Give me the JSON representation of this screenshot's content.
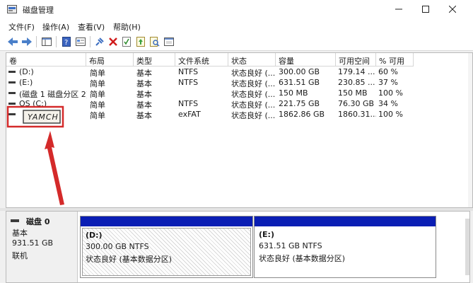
{
  "window": {
    "title": "磁盘管理"
  },
  "menu": [
    "文件(F)",
    "操作(A)",
    "查看(V)",
    "帮助(H)"
  ],
  "columns": [
    "卷",
    "布局",
    "类型",
    "文件系统",
    "状态",
    "容量",
    "可用空间",
    "% 可用"
  ],
  "volumes": [
    {
      "name": "(D:)",
      "layout": "简单",
      "type": "基本",
      "fs": "NTFS",
      "status": "状态良好 (...",
      "capacity": "300.00 GB",
      "free": "179.14 ...",
      "pct": "60 %"
    },
    {
      "name": "(E:)",
      "layout": "简单",
      "type": "基本",
      "fs": "NTFS",
      "status": "状态良好 (...",
      "capacity": "631.51 GB",
      "free": "230.85 ...",
      "pct": "37 %"
    },
    {
      "name": "(磁盘 1 磁盘分区 2)",
      "layout": "简单",
      "type": "基本",
      "fs": "",
      "status": "状态良好 (...",
      "capacity": "150 MB",
      "free": "150 MB",
      "pct": "100 %"
    },
    {
      "name": "OS (C:)",
      "layout": "简单",
      "type": "基本",
      "fs": "NTFS",
      "status": "状态良好 (...",
      "capacity": "221.75 GB",
      "free": "76.30 GB",
      "pct": "34 %"
    },
    {
      "name": "",
      "layout": "简单",
      "type": "基本",
      "fs": "exFAT",
      "status": "状态良好 (...",
      "capacity": "1862.86 GB",
      "free": "1860.31...",
      "pct": "100 %"
    }
  ],
  "disk0": {
    "label": "磁盘 0",
    "type": "基本",
    "size": "931.51 GB",
    "state": "联机"
  },
  "partitions": [
    {
      "letter": "(D:)",
      "size_fs": "300.00 GB NTFS",
      "status": "状态良好 (基本数据分区)"
    },
    {
      "letter": "(E:)",
      "size_fs": "631.51 GB NTFS",
      "status": "状态良好 (基本数据分区)"
    }
  ],
  "annotation": {
    "handwritten": "YAMCH"
  },
  "colors": {
    "partition_bar": "#0a1eb4",
    "annotation": "#d42a2a"
  }
}
